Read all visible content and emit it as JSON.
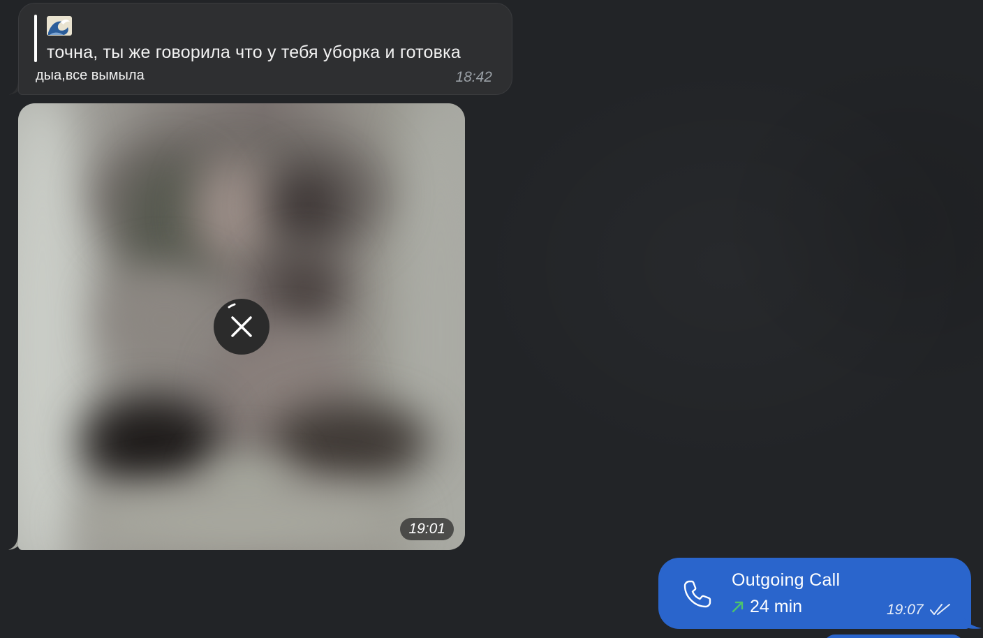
{
  "messages": {
    "incoming_text": {
      "reply_emoji": "wave-emoji",
      "reply_quote": "точна, ты же говорила что у тебя уборка и готовка",
      "text": "дыа,все вымыла",
      "time": "18:42"
    },
    "incoming_photo": {
      "time": "19:01",
      "overlay_icon": "close-icon",
      "download_progress": 0.05
    },
    "outgoing_call": {
      "title": "Outgoing Call",
      "duration": "24 min",
      "time": "19:07",
      "status_icon": "double-check-icon",
      "direction_icon": "arrow-up-right-icon"
    }
  },
  "colors": {
    "background": "#222427",
    "incoming_bubble": "#2e2f31",
    "outgoing_bubble": "#2a65cc",
    "call_arrow": "#4cc36d"
  }
}
